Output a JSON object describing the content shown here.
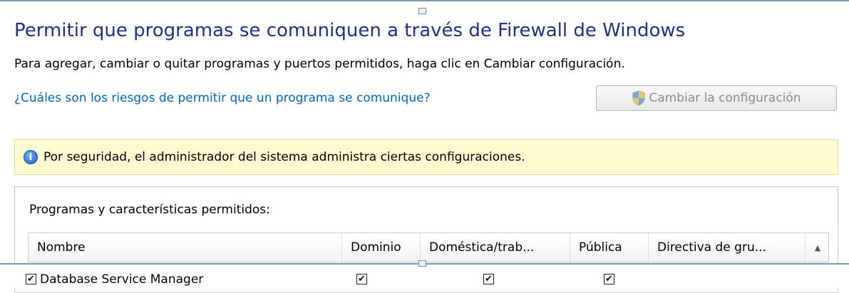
{
  "header": {
    "title": "Permitir que programas se comuniquen a través de Firewall de Windows",
    "description": "Para agregar, cambiar o quitar programas y puertos permitidos, haga clic en Cambiar configuración.",
    "risk_link": "¿Cuáles son los riesgos de permitir que un programa se comunique?",
    "change_settings_button": "Cambiar la configuración"
  },
  "info_bar": {
    "text": "Por seguridad, el administrador del sistema administra ciertas configuraciones."
  },
  "allowed_section": {
    "label": "Programas y características permitidos:",
    "columns": [
      "Nombre",
      "Dominio",
      "Doméstica/trab...",
      "Pública",
      "Directiva de gru..."
    ],
    "rows": [
      {
        "enabled": true,
        "name": "Database Service Manager",
        "domain": true,
        "home_work": true,
        "public": true
      }
    ]
  },
  "icons": {
    "shield": "uac-shield-icon",
    "info": "info-icon",
    "scroll_up": "scroll-up-arrow-icon"
  },
  "colors": {
    "title": "#1e3287",
    "link": "#0066cc",
    "info_bar_bg": "#fdfbd0"
  }
}
